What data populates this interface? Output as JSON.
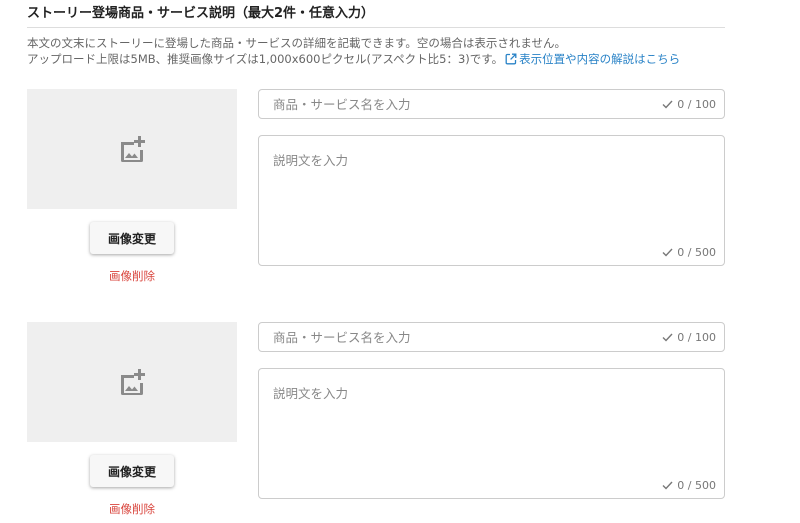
{
  "section": {
    "title": "ストーリー登場商品・サービス説明（最大2件・任意入力）",
    "description_line1": "本文の文末にストーリーに登場した商品・サービスの詳細を記載できます。空の場合は表示されません。",
    "description_line2": "アップロード上限は5MB、推奨画像サイズは1,000x600ピクセル(アスペクト比5：3)です。",
    "help_link": "表示位置や内容の解説はこちら"
  },
  "items": [
    {
      "change_button": "画像変更",
      "delete_link": "画像削除",
      "name_placeholder": "商品・サービス名を入力",
      "name_counter": "0 / 100",
      "desc_placeholder": "説明文を入力",
      "desc_counter": "0 / 500"
    },
    {
      "change_button": "画像変更",
      "delete_link": "画像削除",
      "name_placeholder": "商品・サービス名を入力",
      "name_counter": "0 / 100",
      "desc_placeholder": "説明文を入力",
      "desc_counter": "0 / 500"
    }
  ],
  "icons": {
    "image_placeholder": "add-photo-icon",
    "counter": "check-icon",
    "link": "external-link-icon"
  },
  "colors": {
    "link": "#2a83c7",
    "delete": "#d9453d",
    "image_box": "#efefef"
  }
}
